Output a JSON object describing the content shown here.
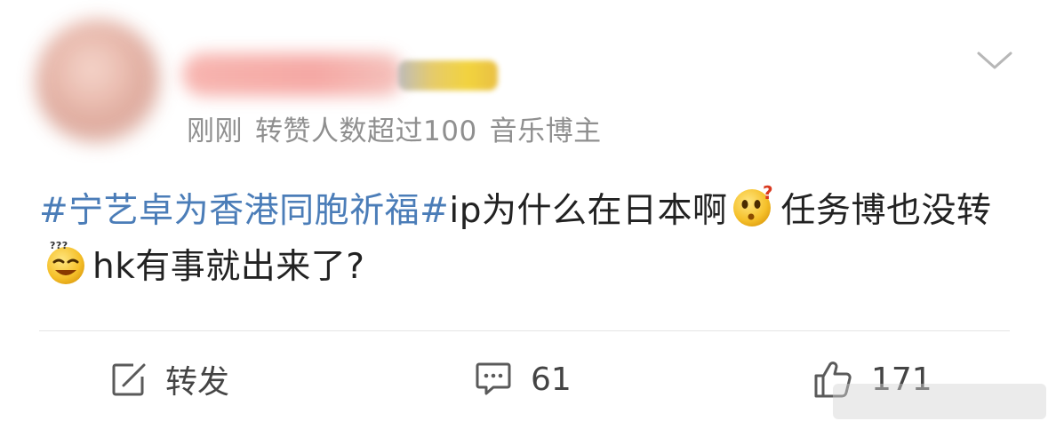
{
  "post": {
    "meta": {
      "time": "刚刚",
      "reposts_note": "转赞人数超过100",
      "tag": "音乐博主"
    },
    "body": {
      "hashtag": "#宁艺卓为香港同胞祈福#",
      "text1": "ip为什么在日本啊",
      "emoji1": "thinking-emoji",
      "text2": "任务博也没转",
      "emoji2": "confused-emoji",
      "text3": "hk有事就出来了?"
    }
  },
  "actions": {
    "repost_label": "转发",
    "comment_count": "61",
    "like_count": "171"
  },
  "icons": {
    "collapse": "chevron-down-icon",
    "repost": "share-edit-icon",
    "comment": "comment-icon",
    "like": "thumbs-up-icon"
  },
  "colors": {
    "hashtag": "#4b7db8",
    "meta_text": "#8f8f8f",
    "body_text": "#222222"
  }
}
